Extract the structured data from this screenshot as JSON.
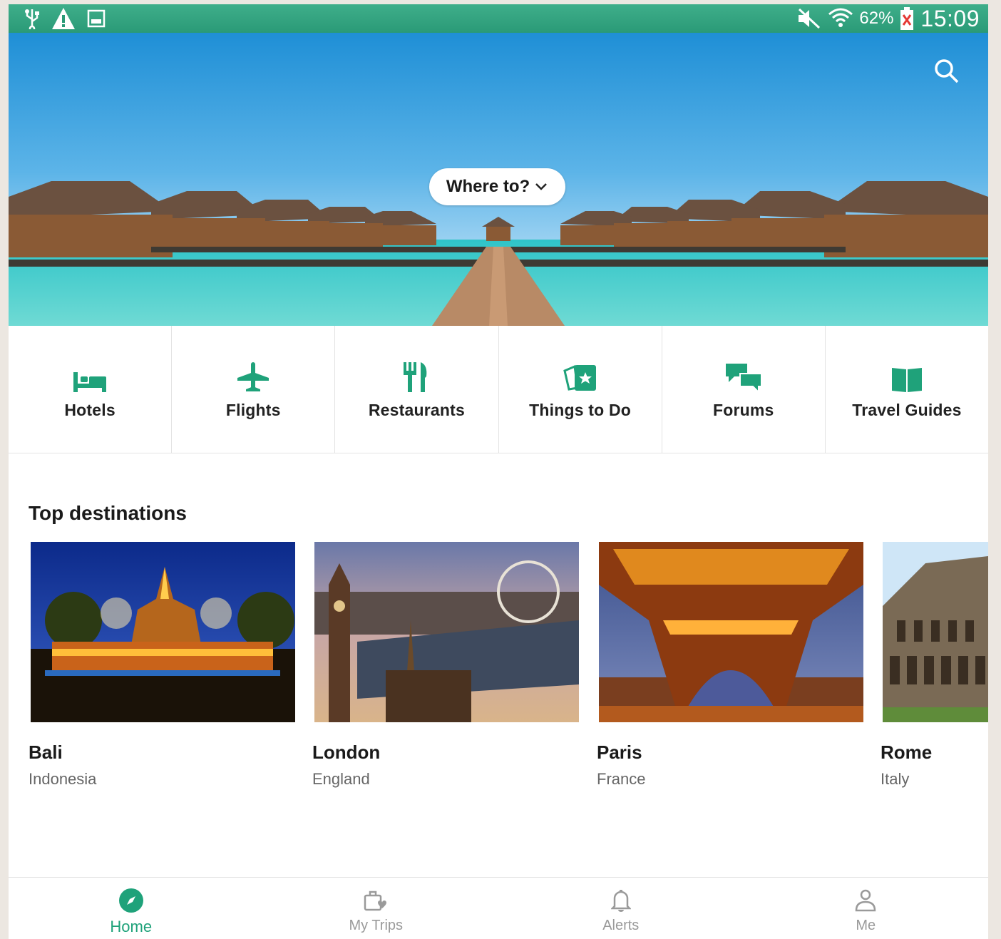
{
  "status_bar": {
    "battery": "62%",
    "time": "15:09"
  },
  "hero": {
    "where_to": "Where to?"
  },
  "categories": [
    {
      "label": "Hotels",
      "icon": "bed-icon"
    },
    {
      "label": "Flights",
      "icon": "airplane-icon"
    },
    {
      "label": "Restaurants",
      "icon": "fork-knife-icon"
    },
    {
      "label": "Things to Do",
      "icon": "ticket-icon"
    },
    {
      "label": "Forums",
      "icon": "chat-bubbles-icon"
    },
    {
      "label": "Travel Guides",
      "icon": "book-icon"
    }
  ],
  "top_destinations": {
    "title": "Top destinations",
    "items": [
      {
        "name": "Bali",
        "country": "Indonesia"
      },
      {
        "name": "London",
        "country": "England"
      },
      {
        "name": "Paris",
        "country": "France"
      },
      {
        "name": "Rome",
        "country": "Italy"
      }
    ]
  },
  "bottom_nav": [
    {
      "label": "Home",
      "icon": "compass-icon",
      "active": true
    },
    {
      "label": "My Trips",
      "icon": "suitcase-heart-icon",
      "active": false
    },
    {
      "label": "Alerts",
      "icon": "bell-icon",
      "active": false
    },
    {
      "label": "Me",
      "icon": "person-icon",
      "active": false
    }
  ],
  "colors": {
    "accent": "#1fa27a",
    "status_bar": "#2a9a77"
  }
}
